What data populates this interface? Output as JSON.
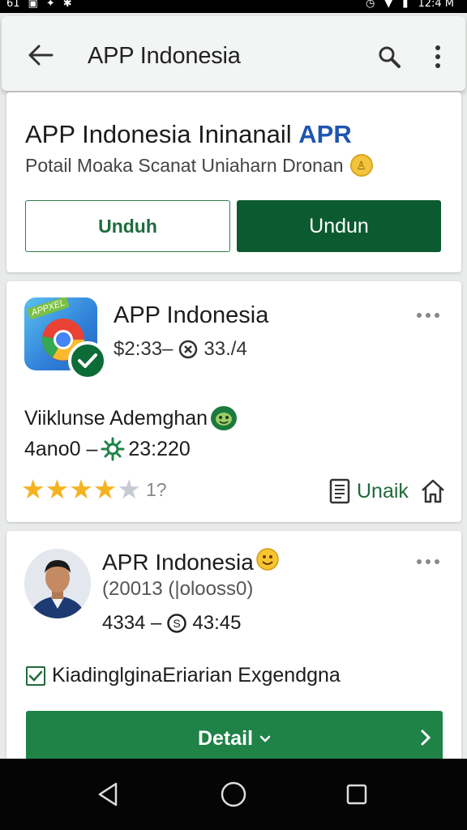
{
  "status_bar": {
    "left": "61",
    "time": "12:4 M"
  },
  "app_bar": {
    "title": "APP Indonesia",
    "back_icon": "arrow-left-icon",
    "search_icon": "search-icon",
    "more_icon": "more-vert-icon"
  },
  "card1": {
    "title": "APP Indonesia Ininanail",
    "title_accent": "APR",
    "subtitle": "Potail Moaka Scanat Uniaharn Dronan",
    "btn_outline": "Unduh",
    "btn_solid": "Undun"
  },
  "card2": {
    "icon_tag": "APPXEL",
    "name": "APP Indonesia",
    "price": "$2:33–",
    "meta_value": "33./4",
    "line1": "Viiklunse Ademghan",
    "line2_a": "4ano0 –",
    "line2_b": "23:220",
    "rating_stars": 4,
    "rating_count": "1?",
    "action_label": "Unaik"
  },
  "card3": {
    "name": "APR Indonesia",
    "sub": "(20013 (|olooss0)",
    "meta_a": "4334 –",
    "meta_b": "43:45",
    "checkbox_label": "KiadinglginaEriarian Exgendgna",
    "detail_label": "Detail"
  },
  "colors": {
    "brand_green": "#0c5a30",
    "accent_blue": "#1e56b0",
    "star": "#f4b320"
  }
}
